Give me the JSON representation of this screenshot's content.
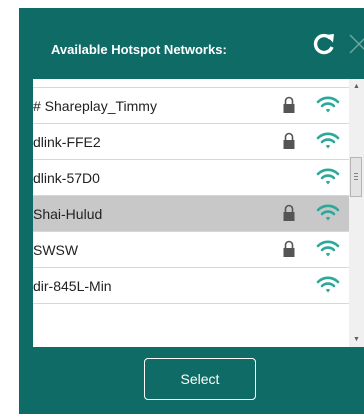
{
  "dialog": {
    "title": "Available Hotspot Networks:",
    "accent_color": "#0e6b65",
    "wifi_color": "#2aa89a",
    "refresh_icon": "refresh-icon",
    "close_icon": "close-icon",
    "select_label": "Select"
  },
  "networks": [
    {
      "name": "# Shareplay_Timmy",
      "secured": true,
      "selected": false
    },
    {
      "name": "dlink-FFE2",
      "secured": true,
      "selected": false
    },
    {
      "name": "dlink-57D0",
      "secured": false,
      "selected": false
    },
    {
      "name": "Shai-Hulud",
      "secured": true,
      "selected": true
    },
    {
      "name": "SWSW",
      "secured": true,
      "selected": false
    },
    {
      "name": "dir-845L-Min",
      "secured": false,
      "selected": false
    }
  ]
}
